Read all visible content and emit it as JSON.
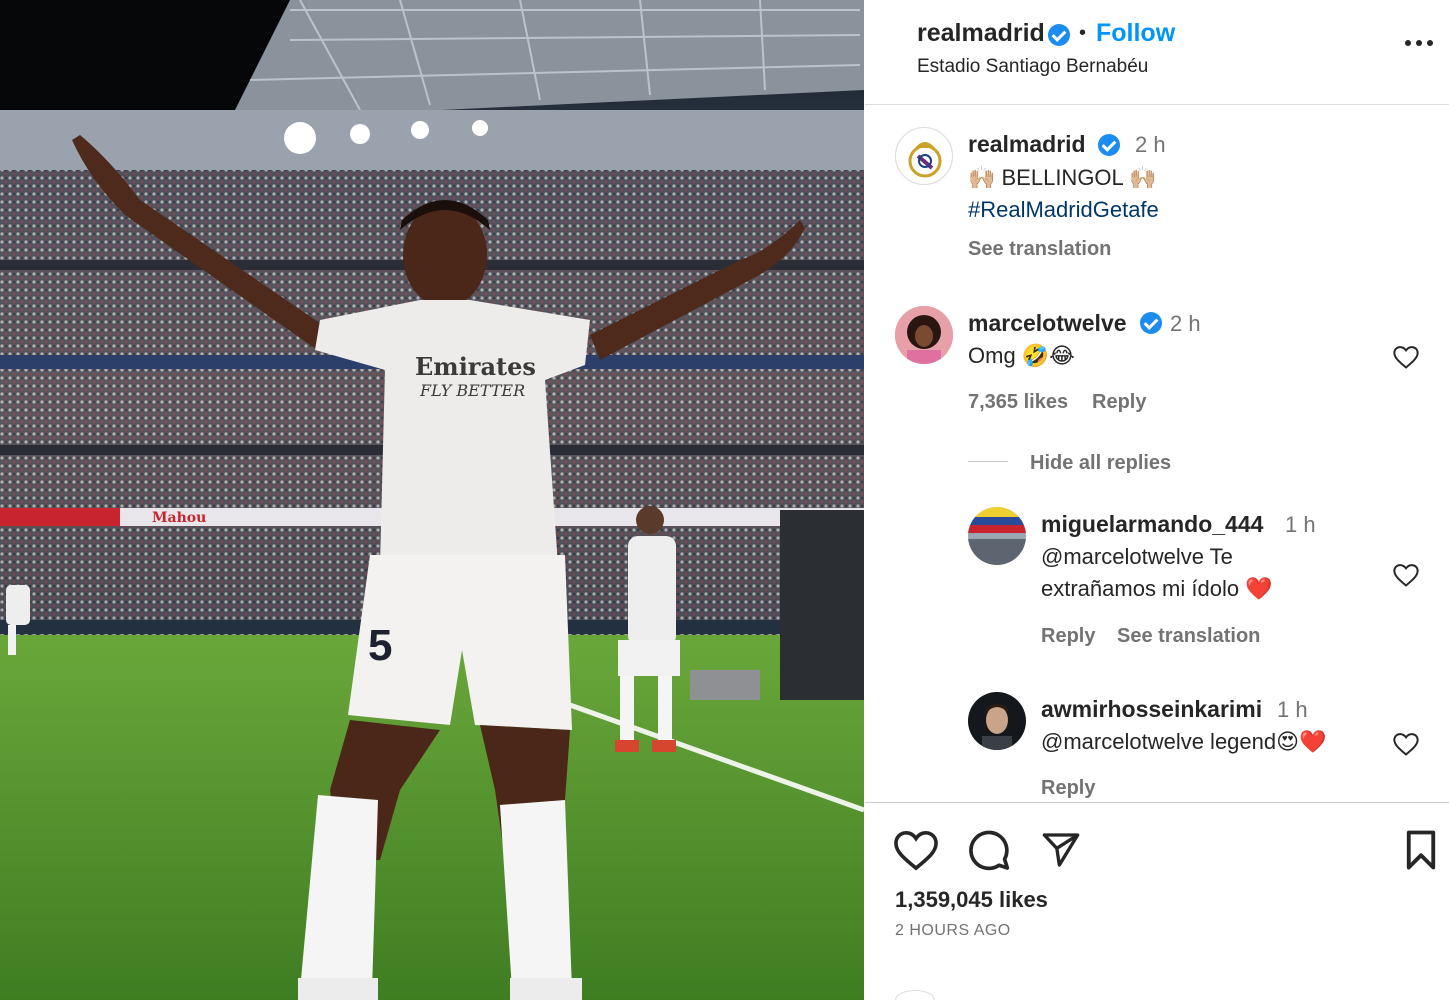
{
  "photo": {
    "alt_icon": "photo-image",
    "jersey_number": "5",
    "sponsor_top": "Emirates",
    "sponsor_bottom": "FLY BETTER",
    "board_text": "Mahou"
  },
  "header": {
    "username": "realmadrid",
    "verified_icon": "verified-badge-icon",
    "separator": "•",
    "follow_label": "Follow",
    "location": "Estadio Santiago Bernabéu",
    "more_icon": "more-options-icon"
  },
  "caption": {
    "username": "realmadrid",
    "time": "2 h",
    "line1": "🙌🏼 BELLINGOL 🙌🏼",
    "line2": "#RealMadridGetafe",
    "see_translation": "See translation"
  },
  "comments": [
    {
      "username": "marcelotwelve",
      "verified": true,
      "time": "2 h",
      "text": "Omg 🤣😂",
      "likes": "7,365 likes",
      "reply_label": "Reply",
      "hide_replies_label": "Hide all replies"
    }
  ],
  "replies": [
    {
      "username": "miguelarmando_444",
      "time": "1 h",
      "text_line1": "@marcelotwelve Te",
      "text_line2": "extrañamos mi ídolo ❤️",
      "reply_label": "Reply",
      "see_translation": "See translation"
    },
    {
      "username": "awmirhosseinkarimi",
      "time": "1 h",
      "text": "@marcelotwelve legend😍❤️",
      "reply_label": "Reply"
    }
  ],
  "actions": {
    "like_icon": "heart-icon",
    "comment_icon": "comment-icon",
    "share_icon": "share-icon",
    "save_icon": "bookmark-icon",
    "likes": "1,359,045 likes",
    "posted": "2 HOURS AGO"
  },
  "colors": {
    "follow": "#0095f6",
    "verified": "#1d8cf0",
    "heart_red": "#e0245e"
  }
}
